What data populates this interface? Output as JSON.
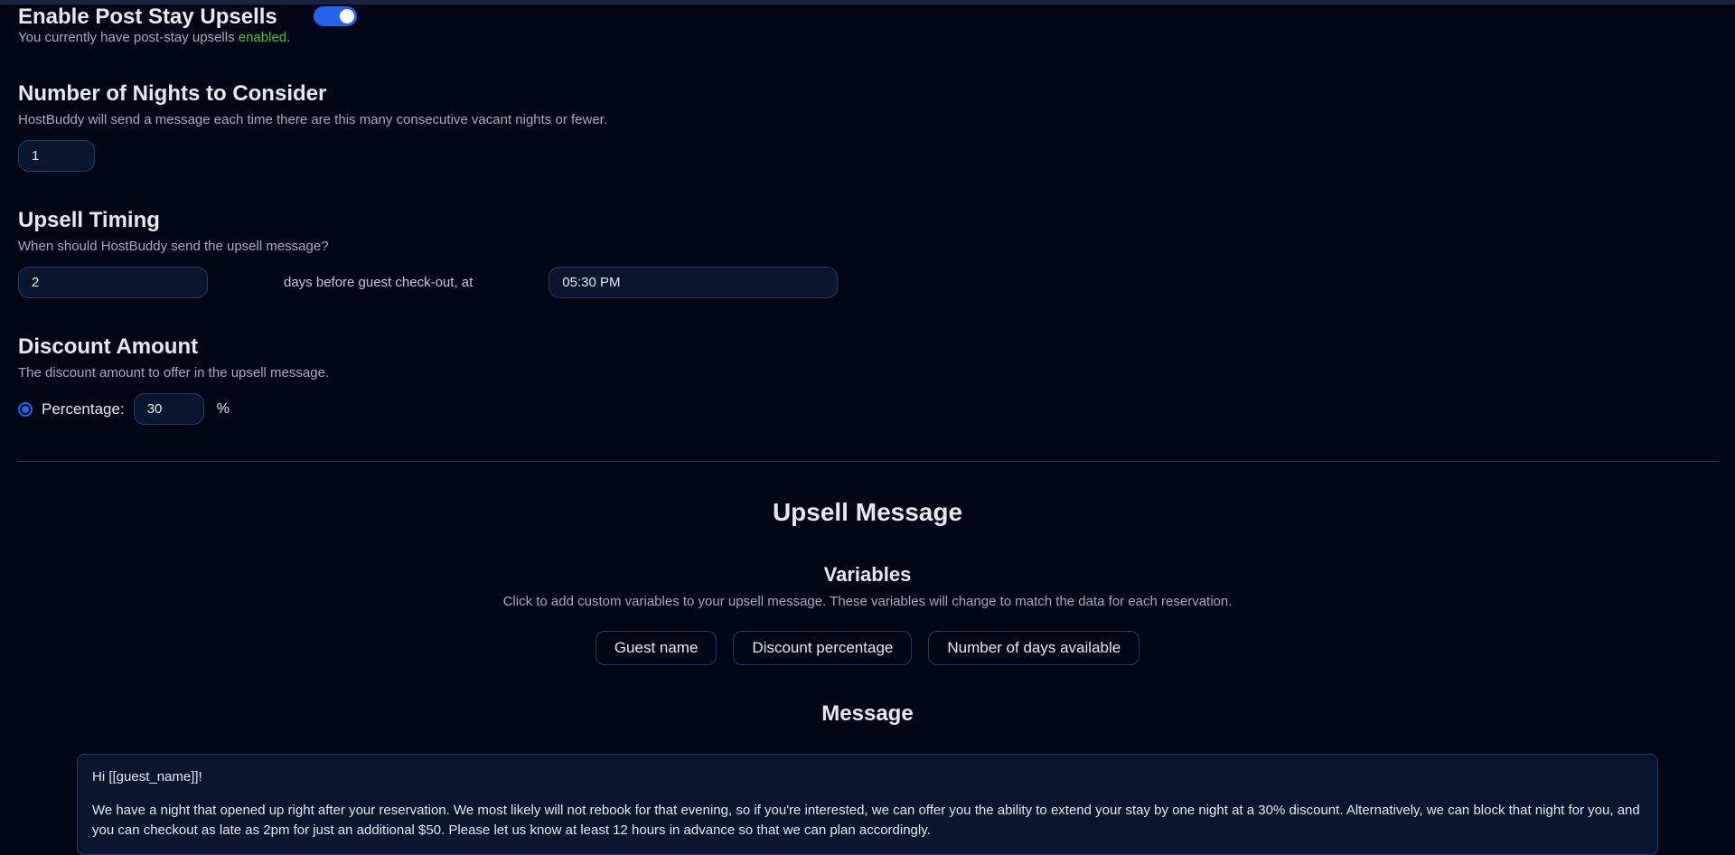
{
  "enable": {
    "title": "Enable Post Stay Upsells",
    "desc_prefix": "You currently have post-stay upsells ",
    "status": "enabled",
    "desc_suffix": "."
  },
  "nights": {
    "title": "Number of Nights to Consider",
    "desc": "HostBuddy will send a message each time there are this many consecutive vacant nights or fewer.",
    "value": "1"
  },
  "timing": {
    "title": "Upsell Timing",
    "desc": "When should HostBuddy send the upsell message?",
    "days_value": "2",
    "mid_label": "days before guest check-out, at",
    "time_value": "05:30 PM"
  },
  "discount": {
    "title": "Discount Amount",
    "desc": "The discount amount to offer in the upsell message.",
    "radio_label": "Percentage:",
    "value": "30",
    "suffix": "%"
  },
  "upsell": {
    "heading": "Upsell Message",
    "variables_heading": "Variables",
    "variables_desc": "Click to add custom variables to your upsell message. These variables will change to match the data for each reservation.",
    "pills": {
      "guest_name": "Guest name",
      "discount_percentage": "Discount percentage",
      "num_days": "Number of days available"
    },
    "message_heading": "Message",
    "message_greeting": "Hi [[guest_name]]!",
    "message_body": "We have a night that opened up right after your reservation. We most likely will not rebook for that evening, so if you're interested, we can offer you the ability to extend your stay by one night at a 30% discount. Alternatively, we can block that night for you, and you can checkout as late as 2pm for just an additional $50. Please let us know at least 12 hours in advance so that we can plan accordingly."
  }
}
